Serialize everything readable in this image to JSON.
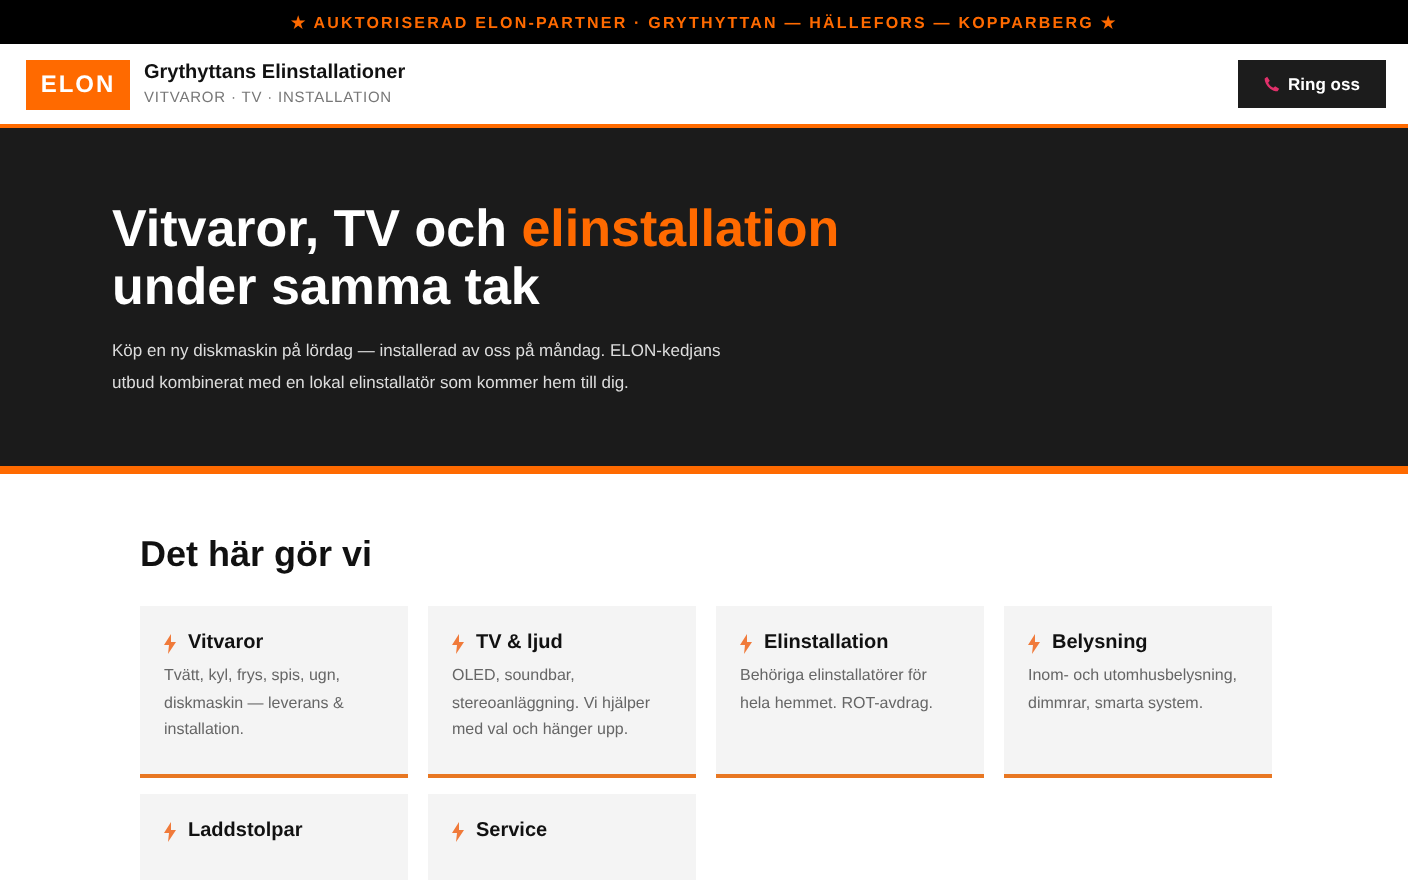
{
  "top_banner": "★ AUKTORISERAD ELON-PARTNER · GRYTHYTTAN — HÄLLEFORS — KOPPARBERG ★",
  "header": {
    "logo": "ELON",
    "name": "Grythyttans Elinstallationer",
    "tagline": "VITVAROR · TV · INSTALLATION",
    "button": "Ring oss"
  },
  "hero": {
    "title_start": "Vitvaror, TV och ",
    "title_highlight": "elinstallation",
    "title_end": "under samma tak",
    "text": "Köp en ny diskmaskin på lördag — installerad av oss på måndag. ELON-kedjans utbud kombinerat med en lokal elinstallatör som kommer hem till dig."
  },
  "services": {
    "heading": "Det här gör vi",
    "items": [
      {
        "title": "Vitvaror",
        "text": "Tvätt, kyl, frys, spis, ugn, diskmaskin — leverans & installation."
      },
      {
        "title": "TV & ljud",
        "text": "OLED, soundbar, stereoanläggning. Vi hjälper med val och hänger upp."
      },
      {
        "title": "Elinstallation",
        "text": "Behöriga elinstallatörer för hela hemmet. ROT-avdrag."
      },
      {
        "title": "Belysning",
        "text": "Inom- och utomhusbelysning, dimmrar, smarta system."
      },
      {
        "title": "Laddstolpar"
      },
      {
        "title": "Service"
      }
    ]
  }
}
